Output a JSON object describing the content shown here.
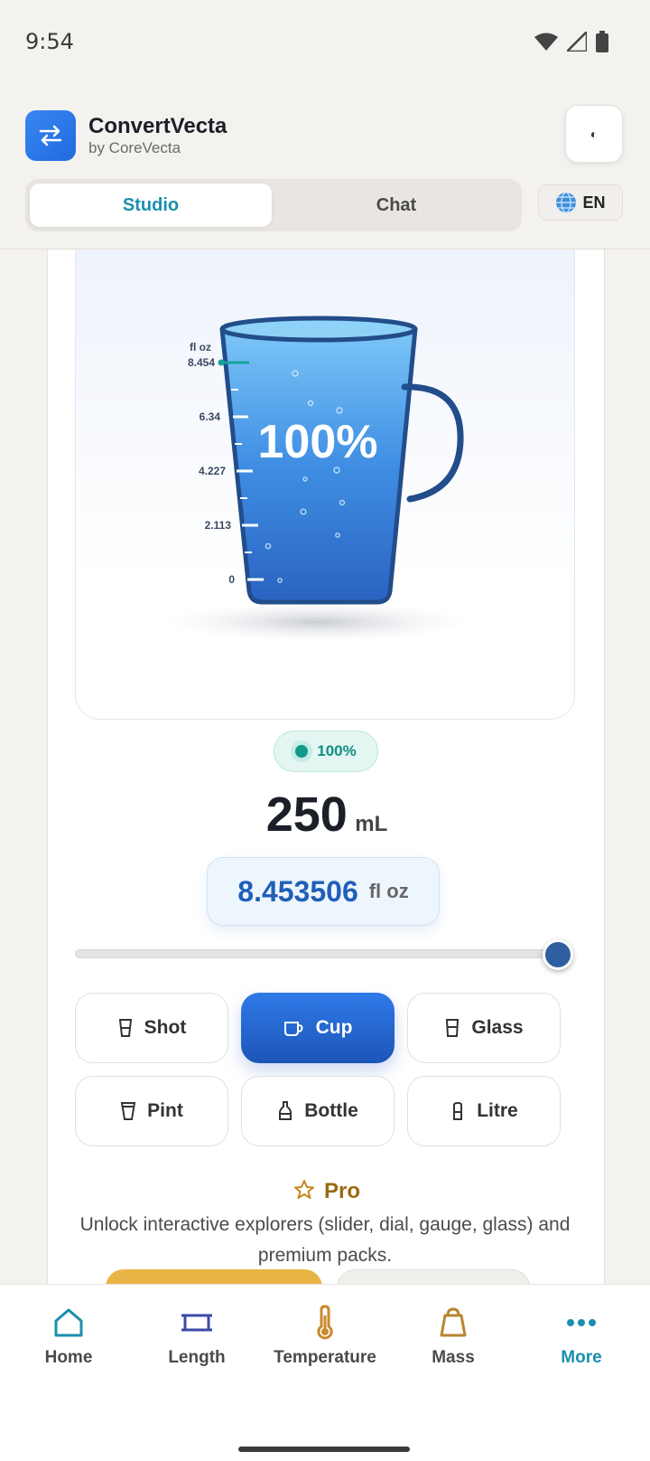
{
  "status": {
    "time": "9:54"
  },
  "header": {
    "title": "ConvertVecta",
    "subtitle": "by CoreVecta",
    "theme_icon": "◐",
    "lang": "EN"
  },
  "tabs": [
    {
      "label": "Studio",
      "active": true
    },
    {
      "label": "Chat",
      "active": false
    }
  ],
  "glass": {
    "scale_unit": "fl oz",
    "ticks": [
      "8.454",
      "6.34",
      "4.227",
      "2.113",
      "0"
    ],
    "fill_percent_label": "100%",
    "fill_fraction": 1.0
  },
  "reading": {
    "badge": "100%",
    "value": "250",
    "unit": "mL",
    "converted_value": "8.453506",
    "converted_unit": "fl oz",
    "slider_fraction": 1.0
  },
  "presets": [
    {
      "label": "Shot",
      "icon": "shot-glass-icon",
      "active": false
    },
    {
      "label": "Cup",
      "icon": "cup-icon",
      "active": true
    },
    {
      "label": "Glass",
      "icon": "glass-icon",
      "active": false
    },
    {
      "label": "Pint",
      "icon": "pint-icon",
      "active": false
    },
    {
      "label": "Bottle",
      "icon": "bottle-icon",
      "active": false
    },
    {
      "label": "Litre",
      "icon": "litre-icon",
      "active": false
    }
  ],
  "pro": {
    "title": "Pro",
    "description": "Unlock interactive explorers (slider, dial, gauge, glass) and premium packs."
  },
  "nav": [
    {
      "label": "Home",
      "icon": "home-icon",
      "active": false
    },
    {
      "label": "Length",
      "icon": "ruler-icon",
      "active": false
    },
    {
      "label": "Temperature",
      "icon": "thermometer-icon",
      "active": false
    },
    {
      "label": "Mass",
      "icon": "weight-icon",
      "active": false
    },
    {
      "label": "More",
      "icon": "more-icon",
      "active": true
    }
  ],
  "colors": {
    "accent": "#1a8fae",
    "primary": "#1f6be0",
    "pro": "#9a6a12",
    "water": "#3d8fe0"
  }
}
